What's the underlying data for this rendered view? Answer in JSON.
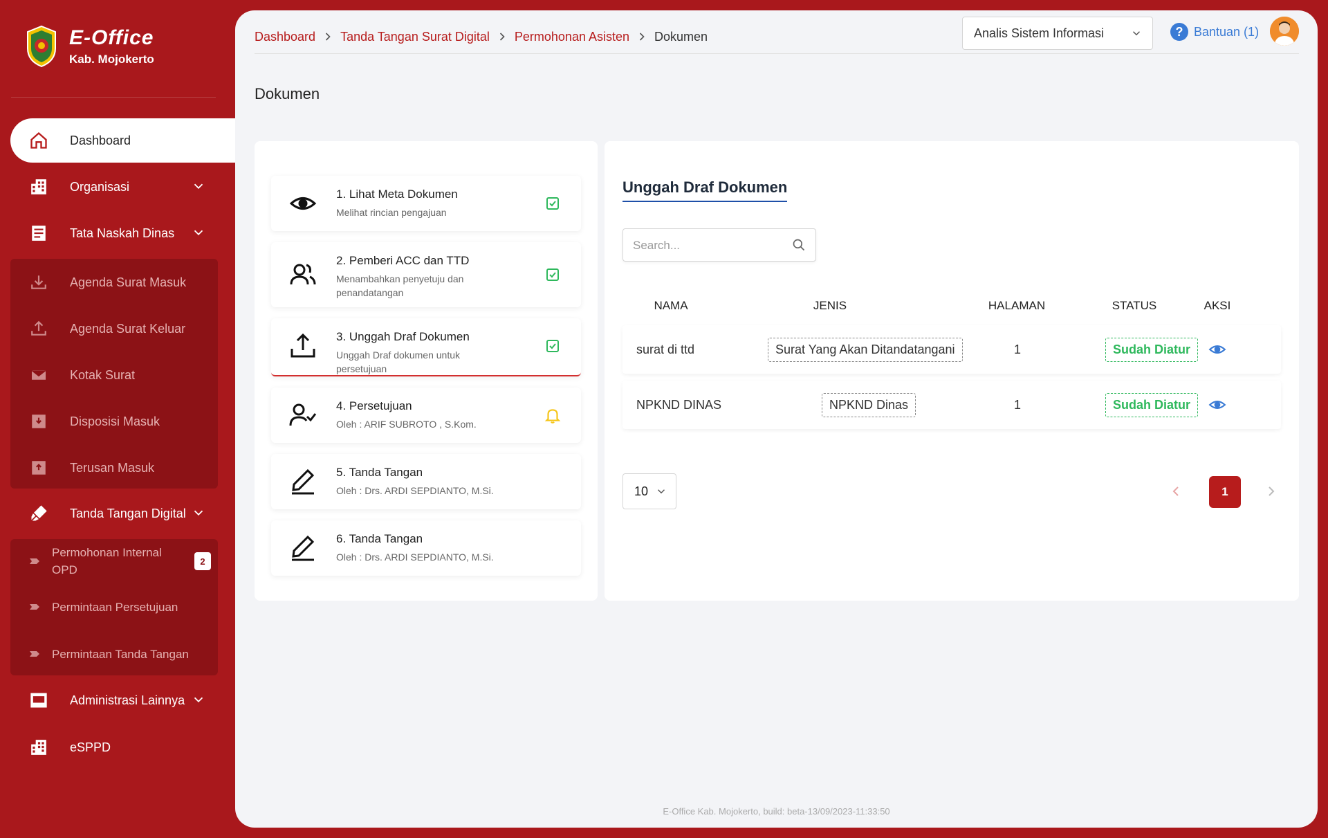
{
  "brand": {
    "title": "E-Office",
    "subtitle": "Kab. Mojokerto"
  },
  "sidebar": {
    "dashboard": "Dashboard",
    "organisasi": "Organisasi",
    "tata_naskah": "Tata Naskah Dinas",
    "tata_sub": [
      "Agenda Surat Masuk",
      "Agenda Surat Keluar",
      "Kotak Surat",
      "Disposisi Masuk",
      "Terusan Masuk"
    ],
    "ttd_digital": "Tanda Tangan Digital",
    "ttd_sub": [
      "Permohonan Internal OPD",
      "Permintaan Persetujuan",
      "Permintaan Tanda Tangan"
    ],
    "ttd_badge": "2",
    "administrasi": "Administrasi Lainnya",
    "esppd": "eSPPD"
  },
  "header": {
    "breadcrumb": [
      "Dashboard",
      "Tanda Tangan Surat Digital",
      "Permohonan Asisten",
      "Dokumen"
    ],
    "role": "Analis Sistem Informasi",
    "help": "Bantuan (1)"
  },
  "page_title": "Dokumen",
  "steps": [
    {
      "title": "1. Lihat Meta Dokumen",
      "sub": "Melihat rincian pengajuan",
      "icon": "eye-icon",
      "status": "check"
    },
    {
      "title": "2. Pemberi ACC dan TTD",
      "sub": "Menambahkan penyetuju dan penandatangan",
      "icon": "users-icon",
      "status": "check"
    },
    {
      "title": "3. Unggah Draf Dokumen",
      "sub": "Unggah Draf dokumen untuk persetujuan",
      "icon": "upload-icon",
      "status": "check"
    },
    {
      "title": "4. Persetujuan",
      "sub": "Oleh : ARIF SUBROTO , S.Kom.",
      "icon": "user-check-icon",
      "status": "bell"
    },
    {
      "title": "5. Tanda Tangan",
      "sub": "Oleh : Drs. ARDI SEPDIANTO, M.Si.",
      "icon": "pen-icon",
      "status": ""
    },
    {
      "title": "6. Tanda Tangan",
      "sub": "Oleh : Drs. ARDI SEPDIANTO, M.Si.",
      "icon": "pen-icon",
      "status": ""
    }
  ],
  "panel": {
    "title": "Unggah Draf Dokumen",
    "search_placeholder": "Search...",
    "columns": [
      "NAMA",
      "JENIS",
      "HALAMAN",
      "STATUS",
      "AKSI"
    ],
    "rows": [
      {
        "nama": "surat di ttd",
        "jenis": "Surat Yang Akan Ditandatangani",
        "halaman": "1",
        "status": "Sudah Diatur"
      },
      {
        "nama": "NPKND DINAS",
        "jenis": "NPKND Dinas",
        "halaman": "1",
        "status": "Sudah Diatur"
      }
    ],
    "page_size": "10",
    "current_page": "1"
  },
  "footer": "E-Office Kab. Mojokerto, build: beta-13/09/2023-11:33:50",
  "colors": {
    "primary": "#a9181c",
    "accent_blue": "#3a7bd5",
    "success": "#2eb85c",
    "warning": "#f5c518"
  }
}
